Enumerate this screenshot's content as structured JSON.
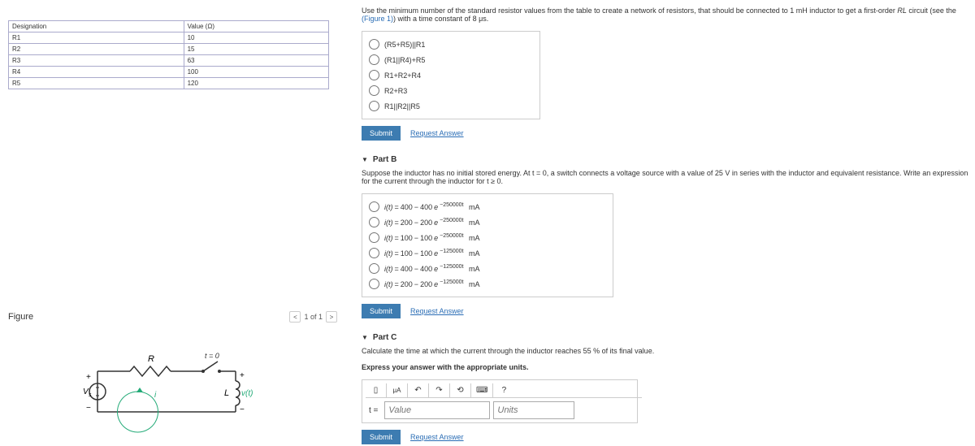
{
  "table": {
    "h1": "Designation",
    "h2": "Value (Ω)",
    "rows": [
      {
        "d": "R1",
        "v": "10"
      },
      {
        "d": "R2",
        "v": "15"
      },
      {
        "d": "R3",
        "v": "63"
      },
      {
        "d": "R4",
        "v": "100"
      },
      {
        "d": "R5",
        "v": "120"
      }
    ]
  },
  "figure": {
    "label": "Figure",
    "nav": "1 of 1",
    "prev": "<",
    "next": ">"
  },
  "partA": {
    "prompt_pre": "Use the minimum number of the standard resistor values from the table to create a network of resistors, that should be connected to ",
    "prompt_ind": "1 mH",
    "prompt_mid": " inductor to get a first-order ",
    "prompt_RL": "RL",
    "prompt_post1": " circuit (see the ",
    "fig_link": "(Figure 1)",
    "prompt_post2": ") with a time constant of ",
    "tc": "8 μs",
    "opts": [
      "(R5+R5)||R1",
      "(R1||R4)+R5",
      "R1+R2+R4",
      "R2+R3",
      "R1||R2||R5"
    ]
  },
  "partB": {
    "title": "Part B",
    "prompt": "Suppose the inductor has no initial stored energy. At t = 0, a switch connects a voltage source with a value of 25 V in series with the inductor and equivalent resistance. Write an expression for the current through the inductor for t ≥ 0.",
    "opts": [
      {
        "a": "400",
        "b": "400",
        "exp": "250000t"
      },
      {
        "a": "200",
        "b": "200",
        "exp": "250000t"
      },
      {
        "a": "100",
        "b": "100",
        "exp": "250000t"
      },
      {
        "a": "100",
        "b": "100",
        "exp": "125000t"
      },
      {
        "a": "400",
        "b": "400",
        "exp": "125000t"
      },
      {
        "a": "200",
        "b": "200",
        "exp": "125000t"
      }
    ],
    "unit": "mA",
    "ivar": "i(t)"
  },
  "partC": {
    "title": "Part C",
    "prompt1": "Calculate the time at which the current through the inductor reaches 55 % of its final value.",
    "prompt2": "Express your answer with the appropriate units.",
    "tlabel": "t =",
    "value_ph": "Value",
    "units_ph": "Units"
  },
  "buttons": {
    "submit": "Submit",
    "request": "Request Answer"
  },
  "tool": {
    "undo": "↶",
    "redo": "↷",
    "reset": "⟲",
    "kb": "⌨",
    "help": "?"
  }
}
